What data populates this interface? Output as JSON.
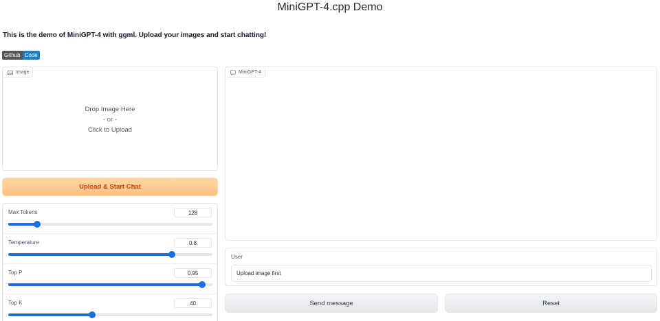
{
  "header": {
    "title": "MiniGPT-4.cpp Demo",
    "description": "This is the demo of MiniGPT-4 with ggml. Upload your images and start chatting!"
  },
  "badge": {
    "left": "Github",
    "right": "Code"
  },
  "image_panel": {
    "label": "Image",
    "drop_line1": "Drop Image Here",
    "drop_or": "- or -",
    "drop_line2": "Click to Upload"
  },
  "upload_button": "Upload & Start Chat",
  "params": [
    {
      "label": "Max Tokens",
      "value": "128",
      "fraction": 0.14
    },
    {
      "label": "Temperature",
      "value": "0.8",
      "fraction": 0.8
    },
    {
      "label": "Top P",
      "value": "0.95",
      "fraction": 0.95
    },
    {
      "label": "Top K",
      "value": "40",
      "fraction": 0.41
    }
  ],
  "chat_panel": {
    "label": "MiniGPT-4"
  },
  "user": {
    "label": "User",
    "placeholder": "Upload image first"
  },
  "buttons": {
    "send": "Send message",
    "reset": "Reset"
  },
  "colors": {
    "accent": "#1d6fdc",
    "upload_text": "#c2410c"
  }
}
